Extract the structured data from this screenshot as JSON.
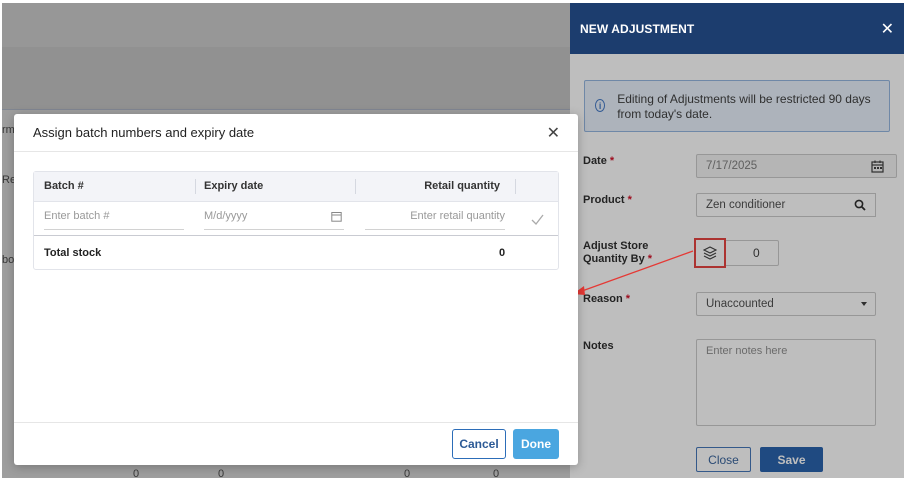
{
  "drawer": {
    "title": "NEW ADJUSTMENT",
    "notice": "Editing of Adjustments will be restricted 90 days from today's date.",
    "fields": {
      "date_label": "Date",
      "date_value": "7/17/2025",
      "product_label": "Product",
      "product_value": "Zen conditioner",
      "adjust_label_line1": "Adjust Store",
      "adjust_label_line2": "Quantity By",
      "adjust_value": "0",
      "reason_label": "Reason",
      "reason_value": "Unaccounted",
      "notes_label": "Notes",
      "notes_placeholder": "Enter notes here"
    },
    "buttons": {
      "close": "Close",
      "save": "Save"
    },
    "required_mark": "*"
  },
  "modal": {
    "title": "Assign batch numbers and expiry date",
    "columns": {
      "batch": "Batch #",
      "expiry": "Expiry date",
      "retail": "Retail quantity"
    },
    "placeholders": {
      "batch": "Enter batch #",
      "expiry": "M/d/yyyy",
      "retail": "Enter retail quantity"
    },
    "total_label": "Total stock",
    "total_value": "0",
    "buttons": {
      "cancel": "Cancel",
      "done": "Done"
    }
  },
  "background": {
    "fragments": [
      "rm",
      "Re",
      "bo",
      "0",
      "0",
      "0",
      "0"
    ]
  },
  "icons": {
    "close": "close-icon",
    "info": "info-icon",
    "calendar": "calendar-icon",
    "search": "search-icon",
    "layers": "layers-icon",
    "check": "check-icon",
    "arrow": "annotation-arrow"
  },
  "colors": {
    "drawer_header": "#1c3d6e",
    "accent": "#1c5aa8",
    "done": "#4aa6e0",
    "highlight": "#e53935"
  }
}
